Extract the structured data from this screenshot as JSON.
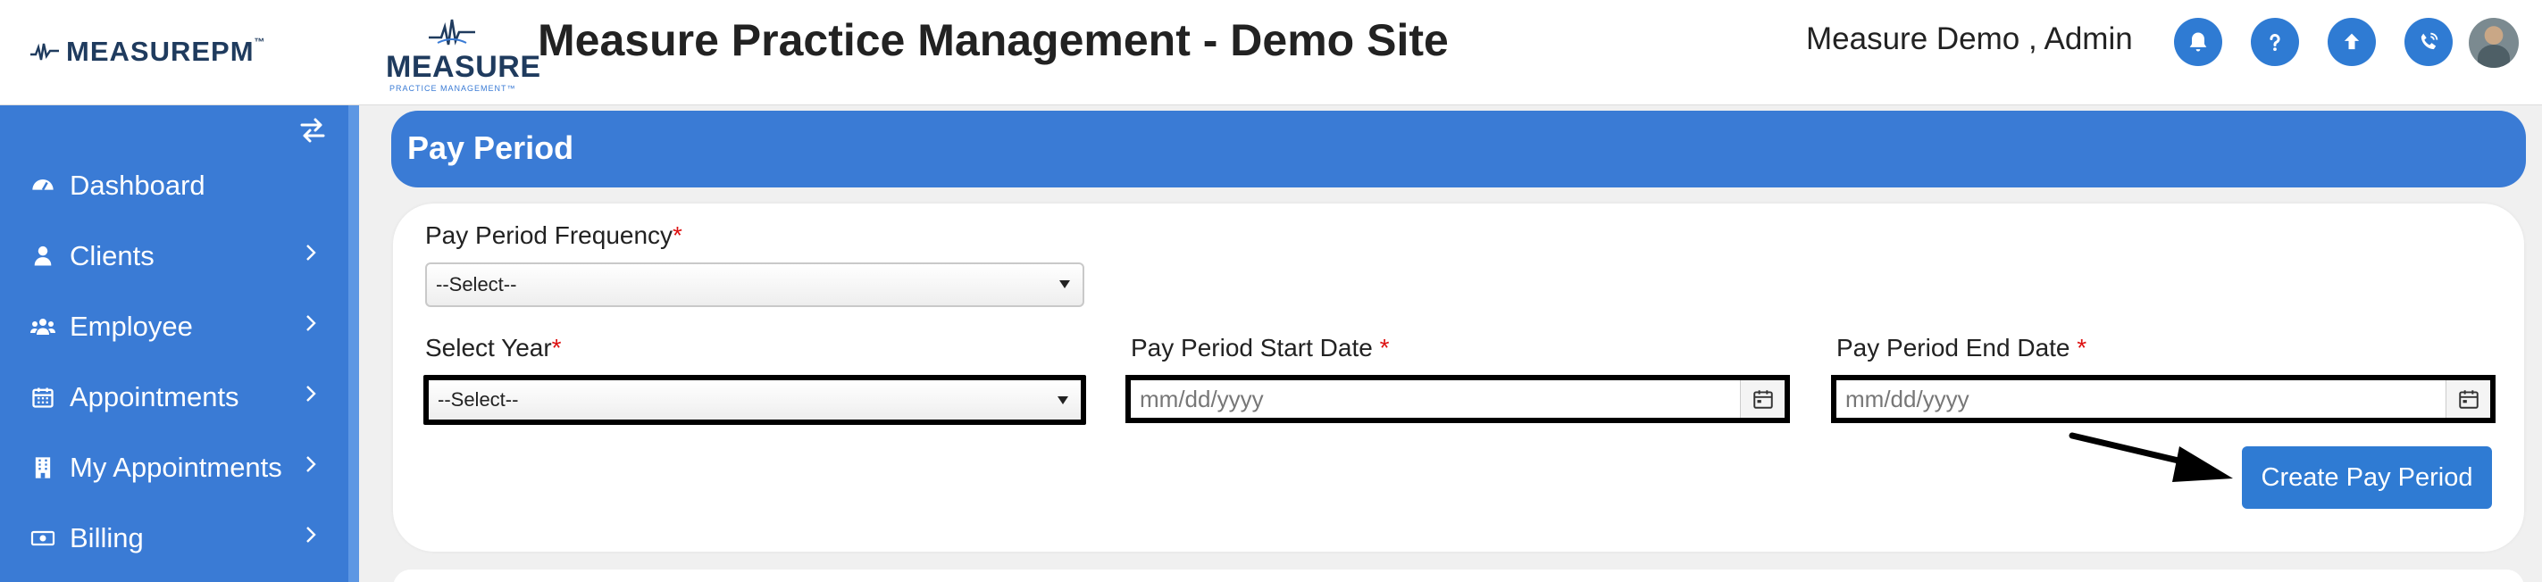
{
  "header": {
    "brand": {
      "measure": "MEASURE",
      "pm": "PM",
      "tm": "™"
    },
    "logo": {
      "word": "MEASURE",
      "sub": "PRACTICE MANAGEMENT™"
    },
    "site_title": "Measure Practice Management - Demo Site",
    "user_name": "Measure Demo , Admin",
    "icons": [
      "bell-icon",
      "help-icon",
      "upload-icon",
      "phone-icon"
    ],
    "accent_color": "#2f7bd3"
  },
  "sidebar": {
    "background": "#3a7bd5",
    "items": [
      {
        "label": "Dashboard",
        "icon": "dashboard-icon",
        "has_submenu": false
      },
      {
        "label": "Clients",
        "icon": "user-icon",
        "has_submenu": true
      },
      {
        "label": "Employee",
        "icon": "users-icon",
        "has_submenu": true
      },
      {
        "label": "Appointments",
        "icon": "calendar-icon",
        "has_submenu": true
      },
      {
        "label": "My Appointments",
        "icon": "building-icon",
        "has_submenu": true
      },
      {
        "label": "Billing",
        "icon": "money-icon",
        "has_submenu": true
      }
    ]
  },
  "main": {
    "page_title": "Pay Period",
    "form": {
      "frequency_label": "Pay Period Frequency",
      "frequency_value": "--Select--",
      "year_label": "Select Year",
      "year_value": "--Select--",
      "start_label": "Pay Period Start Date ",
      "start_placeholder": "mm/dd/yyyy",
      "end_label": "Pay Period End Date ",
      "end_placeholder": "mm/dd/yyyy",
      "required_mark": "*",
      "submit_label": "Create Pay Period"
    }
  }
}
